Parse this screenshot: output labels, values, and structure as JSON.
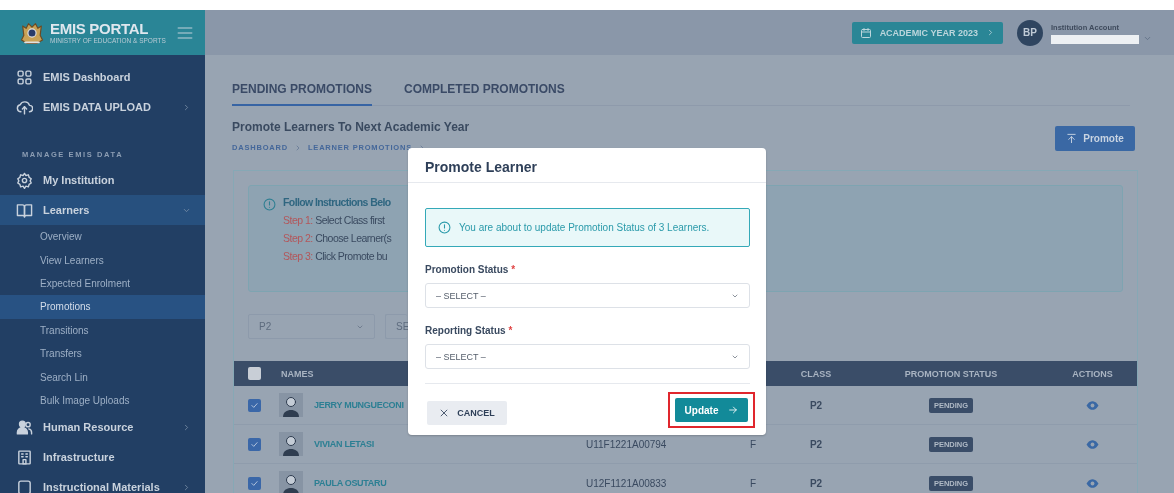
{
  "logo": {
    "title": "EMIS PORTAL",
    "subtitle": "MINISTRY OF EDUCATION & SPORTS"
  },
  "sidebar": {
    "items": [
      {
        "kind": "item",
        "label": "EMIS Dashboard",
        "expandable": false
      },
      {
        "kind": "item",
        "label": "EMIS DATA UPLOAD",
        "expandable": true,
        "expanded": false
      },
      {
        "kind": "heading",
        "label": "MANAGE EMIS DATA"
      },
      {
        "kind": "item",
        "label": "My Institution",
        "expandable": false
      },
      {
        "kind": "item",
        "label": "Learners",
        "expandable": true,
        "expanded": true,
        "children": [
          {
            "label": "Overview",
            "selected": false
          },
          {
            "label": "View Learners",
            "selected": false
          },
          {
            "label": "Expected Enrolment",
            "selected": false
          },
          {
            "label": "Promotions",
            "selected": true
          },
          {
            "label": "Transitions",
            "selected": false
          },
          {
            "label": "Transfers",
            "selected": false
          },
          {
            "label": "Search Lin",
            "selected": false
          },
          {
            "label": "Bulk Image Uploads",
            "selected": false
          }
        ]
      },
      {
        "kind": "item",
        "label": "Human Resource",
        "expandable": true,
        "expanded": false
      },
      {
        "kind": "item",
        "label": "Infrastructure",
        "expandable": false
      },
      {
        "kind": "item",
        "label": "Instructional Materials",
        "expandable": true,
        "expanded": false
      }
    ]
  },
  "topbar": {
    "academic_year": "ACADEMIC YEAR 2023",
    "avatar": "BP",
    "account_label": "Institution Account"
  },
  "tabs": [
    {
      "label": "PENDING PROMOTIONS",
      "selected": true
    },
    {
      "label": "COMPLETED PROMOTIONS",
      "selected": false
    }
  ],
  "page_title": "Promote Learners To Next Academic Year",
  "breadcrumb": [
    "DASHBOARD",
    "LEARNER PROMOTIONS"
  ],
  "promote_button": "Promote",
  "instructions": {
    "title": "Follow Instructions Belo",
    "steps": [
      {
        "label": "Step 1:",
        "text": "Select Class first"
      },
      {
        "label": "Step 2:",
        "text": "Choose Learner(s"
      },
      {
        "label": "Step 3:",
        "text": "Click Promote bu"
      }
    ]
  },
  "filters": [
    {
      "value": "P2"
    },
    {
      "value": "SE"
    }
  ],
  "table": {
    "all_checked": false,
    "columns": [
      "NAMES",
      "CLASS",
      "PROMOTION STATUS",
      "ACTIONS"
    ],
    "rows": [
      {
        "name": "JERRY MUNGUECONI",
        "class": "P2",
        "status": "PENDING",
        "checked": true
      },
      {
        "name": "VIVIAN LETASI",
        "lin": "U11F1221A00794",
        "gender": "F",
        "class": "P2",
        "status": "PENDING",
        "checked": true
      },
      {
        "name": "PAULA OSUTARU",
        "lin": "U12F1121A00833",
        "gender": "F",
        "class": "P2",
        "status": "PENDING",
        "checked": true
      }
    ]
  },
  "modal": {
    "title": "Promote Learner",
    "alert": "You are about to update Promotion Status of 3 Learners.",
    "fields": [
      {
        "label": "Promotion Status",
        "required_mark": "*",
        "value": "– SELECT –"
      },
      {
        "label": "Reporting Status",
        "required_mark": "*",
        "value": "– SELECT –"
      }
    ],
    "cancel": "CANCEL",
    "update": "Update",
    "update_highlighted": true
  }
}
